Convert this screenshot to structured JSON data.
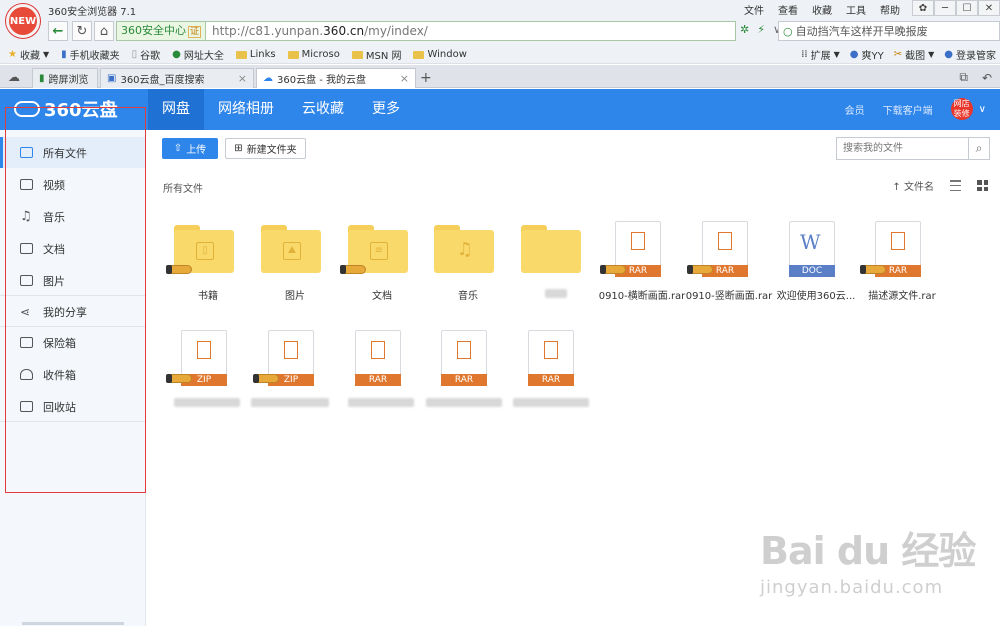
{
  "browser": {
    "title": "360安全浏览器 7.1",
    "new_badge": "NEW",
    "menu": [
      "文件",
      "查看",
      "收藏",
      "工具",
      "帮助"
    ],
    "security_label": "360安全中心",
    "cert_badge": "证",
    "url_prefix": "http://c81.yunpan.",
    "url_domain": "360.cn",
    "url_suffix": "/my/index/",
    "search_text": "自动挡汽车这样开早晚报废",
    "bookmarks": [
      "收藏",
      "手机收藏夹",
      "谷歌",
      "网址大全",
      "Links",
      "Microso",
      "MSN 网",
      "Window"
    ],
    "bookmarks_right": [
      "扩展",
      "爽YY",
      "截图",
      "登录管家"
    ],
    "tabs": [
      {
        "label": "跨屏浏览"
      },
      {
        "label": "360云盘_百度搜索"
      },
      {
        "label": "360云盘 - 我的云盘"
      }
    ]
  },
  "app": {
    "logo": "360云盘",
    "nav": [
      "网盘",
      "网络相册",
      "云收藏",
      "更多"
    ],
    "header_right": [
      "会员",
      "下载客户端"
    ],
    "avatar_text": "网店装修",
    "sidebar": [
      {
        "label": "所有文件",
        "icon": "cloud-folder-icon"
      },
      {
        "label": "视频",
        "icon": "video-icon"
      },
      {
        "label": "音乐",
        "icon": "music-icon"
      },
      {
        "label": "文档",
        "icon": "document-icon"
      },
      {
        "label": "图片",
        "icon": "image-icon"
      },
      {
        "label": "我的分享",
        "icon": "share-icon"
      },
      {
        "label": "保险箱",
        "icon": "safe-icon"
      },
      {
        "label": "收件箱",
        "icon": "inbox-icon"
      },
      {
        "label": "回收站",
        "icon": "trash-icon"
      }
    ],
    "toolbar": {
      "upload": "上传",
      "new_folder": "新建文件夹",
      "search_placeholder": "搜索我的文件"
    },
    "breadcrumb": "所有文件",
    "sort_label": "文件名",
    "files_row1": [
      {
        "name": "书籍",
        "type": "folder",
        "emblem": "book"
      },
      {
        "name": "图片",
        "type": "folder",
        "emblem": "image"
      },
      {
        "name": "文档",
        "type": "folder",
        "emblem": "doc"
      },
      {
        "name": "音乐",
        "type": "folder",
        "emblem": "music"
      },
      {
        "name": "",
        "type": "folder",
        "emblem": ""
      },
      {
        "name": "0910-横断画面.rar",
        "type": "RAR"
      },
      {
        "name": "0910-竖断画面.rar",
        "type": "RAR"
      },
      {
        "name": "欢迎使用360云...",
        "type": "DOC"
      },
      {
        "name": "描述源文件.rar",
        "type": "RAR"
      }
    ],
    "files_row2": [
      {
        "name": "",
        "type": "ZIP"
      },
      {
        "name": "",
        "type": "ZIP"
      },
      {
        "name": "",
        "type": "RAR"
      },
      {
        "name": "",
        "type": "RAR"
      },
      {
        "name": "",
        "type": "RAR"
      }
    ],
    "colors": {
      "accent": "#2f86ea",
      "rar": "#e0772e",
      "doc": "#5a7fc7",
      "folder": "#fad96b"
    }
  },
  "watermark": {
    "line1": "Bai du 经验",
    "line2": "jingyan.baidu.com"
  }
}
